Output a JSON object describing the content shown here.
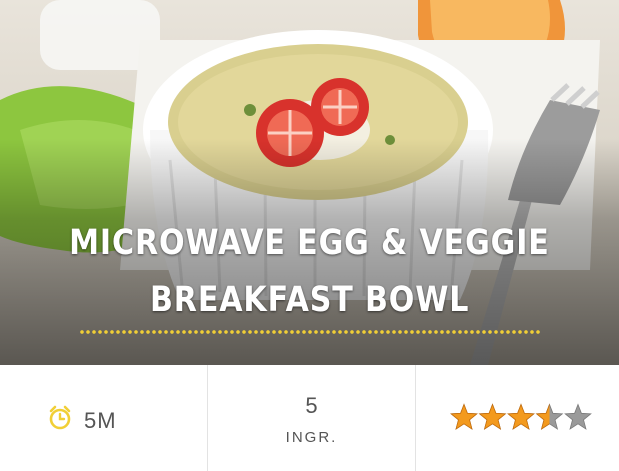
{
  "recipe": {
    "title_line1": "MICROWAVE EGG & VEGGIE",
    "title_line2": "BREAKFAST BOWL",
    "time": "5M",
    "ingredient_count": "5",
    "ingredient_label": "INGR.",
    "rating": 3.5,
    "rating_max": 5
  },
  "icons": {
    "time": "alarm-clock-icon",
    "rating": "star-icon"
  },
  "colors": {
    "accent": "#f1cf36",
    "text": "#555555",
    "star_filled": "#f39a1e",
    "star_empty": "#9a9a9a"
  }
}
